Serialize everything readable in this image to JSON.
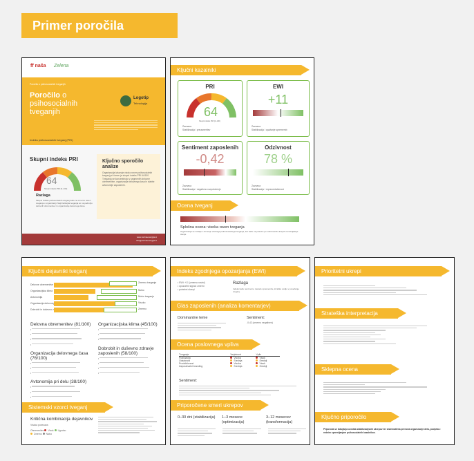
{
  "banner": "Primer poročila",
  "colors": {
    "accent": "#f5b82e",
    "green": "#7cbd4b",
    "red": "#c8312d"
  },
  "p1": {
    "logo1": "ff naša",
    "logo2": "Zelena",
    "sub_top": "Poročilo o psihosocialnih tveganjih",
    "title_bold": "Poročilo",
    "title_rest": " o psihosocialnih tveganjih",
    "logo_text": "Logotip",
    "logo_sub": "Tehnologija",
    "topic": "Indeks psihosocialnih tveganj (PRI)",
    "pri_title": "Skupni indeks PRI",
    "pri_value": "64",
    "gauge_caption": "Skupni indeks PRI (0–100)",
    "razlaga_title": "Razlaga",
    "razlaga_text": "Skupni indeks psihosocialnih tveganj kaže na zmerno raven tveganja v organizaciji. Najizrazitejša tveganja so na področju delovnih obremenitev in organizacije delovnega časa.",
    "kljucno_title": "Ključno sporočilo analize",
    "kljucno_text": "Organizacija izkazuje visoko raven psihosocialnih tveganj pri čemer je skupni indeks PRI 64/100. Tveganja se koncentrirajo v segmentih delovne obremenitve, organizacije delovnega časa in slabše avtonomije zaposlenih.",
    "footer1": "www.vetrnaenergija.si",
    "footer2": "info@vetrnaenergija.si"
  },
  "p2": {
    "sec1": "Ključni kazalniki",
    "pri": {
      "title": "PRI",
      "value": "64",
      "caption": "Skupni indeks PRI (0–100)",
      "note1": "Zaznava",
      "note2": "Stabilizacija / preusmeritev"
    },
    "ewi": {
      "title": "EWI",
      "value": "+11",
      "note1": "Zaznava",
      "note2": "Stabilizacija / opažanje sprememb"
    },
    "sent": {
      "title": "Sentiment zaposlenih",
      "value": "-0,42",
      "note1": "Zaznava",
      "note2": "Stabilizacija / negativno razpoloženje"
    },
    "odz": {
      "title": "Odzivnost",
      "value": "78 %",
      "note1": "Zaznava",
      "note2": "Stabilizacija / reprezentativnost"
    },
    "sec2": "Ocena tveganj",
    "overall": "Splošna ocena: visoka raven tveganja",
    "overall_text": "Organizacija se nahaja v območju visokega psihosocialnega tveganja, kar kaže na potrebo po načrtovanih ukrepih za izboljšanje stanja."
  },
  "p3": {
    "sec1": "Ključni dejavniki tveganj",
    "bars": [
      {
        "label": "Delovne obremenitve",
        "value": "81",
        "box": "Zmerno tveganje"
      },
      {
        "label": "Organizacijska klima",
        "value": "45",
        "box": "Nizko"
      },
      {
        "label": "Avtonomija",
        "value": "38",
        "box": "Nizko tveganje"
      },
      {
        "label": "Organizacija delovnega časa",
        "value": "76",
        "box": "Visoko"
      },
      {
        "label": "Dobrobit in duševno zdravje",
        "value": "58",
        "box": "Zmerno"
      }
    ],
    "f1": "Delovna obremenitev (81/100)",
    "f2": "Organizacijska klima (45/100)",
    "f3": "Organizacija delovnega časa (76/100)",
    "f4": "Dobrobit in duševno zdravje zaposlenih (58/100)",
    "f5": "Avtonomija pri delu (38/100)",
    "sec2": "Sistemski vzorci tveganj",
    "combo": "Kritična kombinacija dejavnikov",
    "combo_sub": "Visoka povezava",
    "legend": [
      "Obremenitev",
      "Visok",
      "Ugodno",
      "Zmerno",
      "Nizko"
    ]
  },
  "p4": {
    "sec1": "Indeks zgodnjega opozarjanja (EWI)",
    "ewi_items": [
      "EWI: +11 (zmerno rastni)",
      "opozorilni signal: zmerni",
      "potrebni ukrepi"
    ],
    "razlaga": "Razlaga",
    "razlaga_text": "Indeks kaže na zmerno rastoče spremembe, ki lahko vodijo v povečanje tveganj.",
    "sec2": "Glas zaposlenih (analiza komentarjev)",
    "teme": "Dominantne teme",
    "sentiment": "Sentiment:",
    "sentiment_text": "-0,42 (zmerno negativen)",
    "sec3": "Ocena poslovnega vpliva",
    "table_head": [
      "Tveganje",
      "Verjetnost",
      "Vpliv"
    ],
    "table_rows": [
      {
        "t": "Fluktuacija",
        "v": "Visoka",
        "i": "Visok"
      },
      {
        "t": "Odsotnost",
        "v": "Srednja",
        "i": "Srednji"
      },
      {
        "t": "Produktivnost",
        "v": "Visoka",
        "i": "Visok"
      },
      {
        "t": "Zaposlovalni branding",
        "v": "Srednja",
        "i": "Srednji"
      }
    ],
    "sentiment2": "Sentiment:",
    "sec4": "Priporočene smeri ukrepov",
    "col1": "0–30 dni (stabilizacija)",
    "col2": "1–3 mesece (optimizacija)",
    "col3": "3–12 mesecev (transformacija)"
  },
  "p5": {
    "sec1": "Prioritetni ukrepi",
    "sec2": "Strateška interpretacija",
    "sec3": "Sklepna ocena",
    "sec4": "Ključno priporočilo",
    "key_text": "Priporoča se takojšnja uvedba stabilizacijskih ukrepov ter sistematična prenova organizacije dela, podprta z rednim spremljanjem psihosocialnih kazalnikov."
  }
}
